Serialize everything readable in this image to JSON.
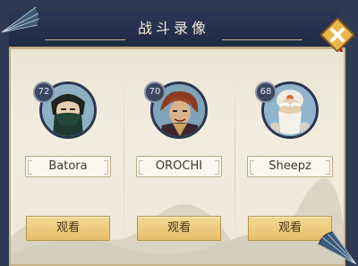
{
  "title": "战斗录像",
  "players": [
    {
      "name": "Batora",
      "level": "72",
      "watch_label": "观看",
      "avatar_icon": "masked-ninja-portrait"
    },
    {
      "name": "OROCHI",
      "level": "70",
      "watch_label": "观看",
      "avatar_icon": "red-haired-warrior-portrait"
    },
    {
      "name": "Sheepz",
      "level": "68",
      "watch_label": "观看",
      "avatar_icon": "white-bearded-elder-portrait"
    }
  ],
  "colors": {
    "title_bar": "#1f2a44",
    "panel_bg": "#ece6d6",
    "button_gold": "#e6bf6a",
    "close_button": "#e7b74a"
  }
}
